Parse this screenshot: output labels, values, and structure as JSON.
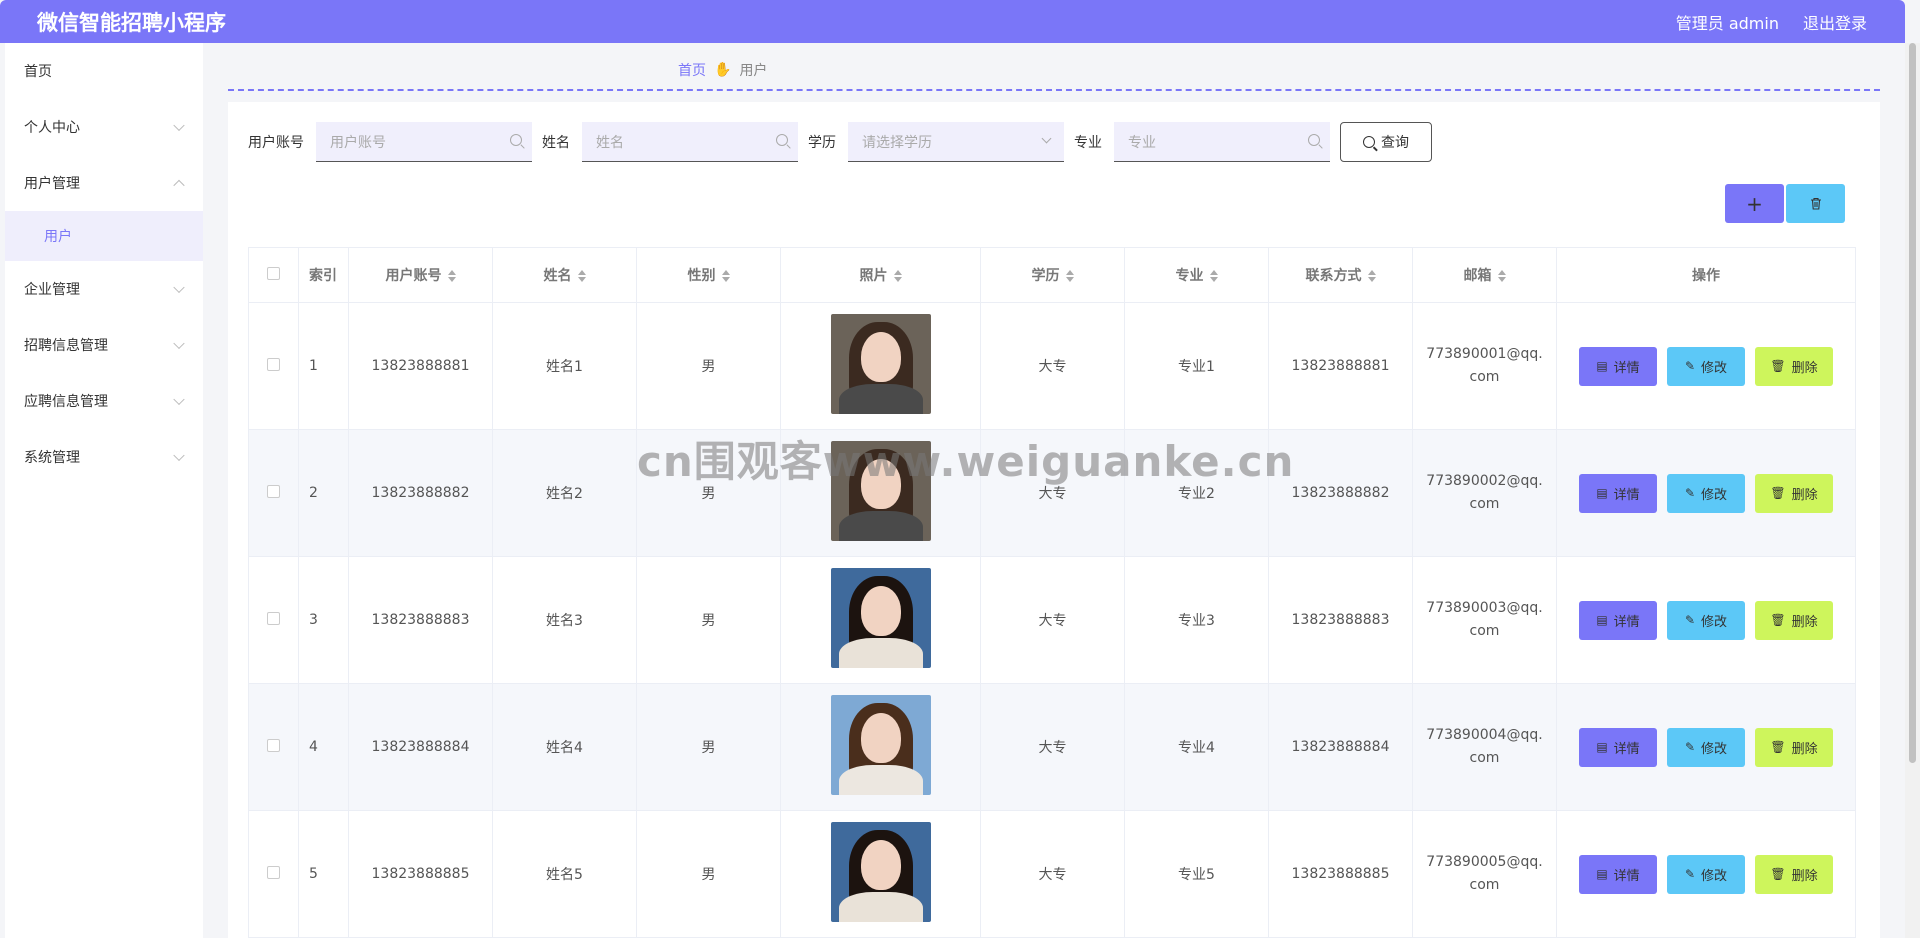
{
  "header": {
    "title": "微信智能招聘小程序",
    "admin": "管理员 admin",
    "logout": "退出登录"
  },
  "sidebar": {
    "items": [
      {
        "label": "首页",
        "chevron": "none"
      },
      {
        "label": "个人中心",
        "chevron": "down"
      },
      {
        "label": "用户管理",
        "chevron": "up"
      },
      {
        "label": "用户",
        "chevron": "none",
        "sub": true
      },
      {
        "label": "企业管理",
        "chevron": "down"
      },
      {
        "label": "招聘信息管理",
        "chevron": "down"
      },
      {
        "label": "应聘信息管理",
        "chevron": "down"
      },
      {
        "label": "系统管理",
        "chevron": "down"
      }
    ]
  },
  "breadcrumb": {
    "home": "首页",
    "current": "用户",
    "icon": "hand-icon"
  },
  "search": {
    "account_label": "用户账号",
    "account_placeholder": "用户账号",
    "name_label": "姓名",
    "name_placeholder": "姓名",
    "edu_label": "学历",
    "edu_placeholder": "请选择学历",
    "major_label": "专业",
    "major_placeholder": "专业",
    "query_button": "查询"
  },
  "toolbar": {
    "add_label": "+",
    "delete_icon": "trash-icon"
  },
  "table": {
    "headers": [
      "索引",
      "用户账号",
      "姓名",
      "性别",
      "照片",
      "学历",
      "专业",
      "联系方式",
      "邮箱",
      "操作"
    ],
    "rows": [
      {
        "index": "1",
        "account": "13823888881",
        "name": "姓名1",
        "gender": "男",
        "edu": "大专",
        "major": "专业1",
        "phone": "13823888881",
        "email": "773890001@qq.com"
      },
      {
        "index": "2",
        "account": "13823888882",
        "name": "姓名2",
        "gender": "男",
        "edu": "大专",
        "major": "专业2",
        "phone": "13823888882",
        "email": "773890002@qq.com"
      },
      {
        "index": "3",
        "account": "13823888883",
        "name": "姓名3",
        "gender": "男",
        "edu": "大专",
        "major": "专业3",
        "phone": "13823888883",
        "email": "773890003@qq.com"
      },
      {
        "index": "4",
        "account": "13823888884",
        "name": "姓名4",
        "gender": "男",
        "edu": "大专",
        "major": "专业4",
        "phone": "13823888884",
        "email": "773890004@qq.com"
      },
      {
        "index": "5",
        "account": "13823888885",
        "name": "姓名5",
        "gender": "男",
        "edu": "大专",
        "major": "专业5",
        "phone": "13823888885",
        "email": "773890005@qq.com"
      }
    ],
    "actions": {
      "detail": "详情",
      "edit": "修改",
      "delete": "删除"
    }
  },
  "watermark": "cn围观客www.weiguanke.cn",
  "colors": {
    "primary": "#7a76f8",
    "edit": "#5cc8f7",
    "delete": "#cef55c"
  }
}
